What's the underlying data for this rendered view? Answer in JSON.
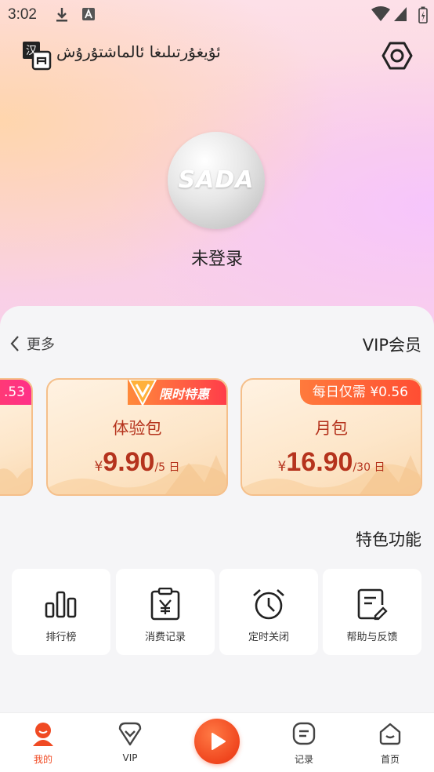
{
  "status_bar": {
    "time": "3:02"
  },
  "header": {
    "app_name": "ئۇيغۇرتىلىغا ئالماشتۇرۇش",
    "lang_icon_text": "汉"
  },
  "profile": {
    "avatar_logo": "SADA",
    "login_status": "未登录"
  },
  "vip": {
    "more_label": "更多",
    "section_title": "VIP会员",
    "partial_card_badge": ".53",
    "plans": [
      {
        "name": "体验包",
        "currency": "¥",
        "price": "9.90",
        "period": "/5 日",
        "badge": "限时特惠"
      },
      {
        "name": "月包",
        "currency": "¥",
        "price": "16.90",
        "period": "/30 日",
        "badge": "每日仅需 ¥0.56"
      }
    ]
  },
  "features": {
    "title": "特色功能",
    "items": [
      {
        "label": "排行榜",
        "icon": "bar-chart-icon"
      },
      {
        "label": "消费记录",
        "icon": "receipt-icon"
      },
      {
        "label": "定时关闭",
        "icon": "alarm-clock-icon"
      },
      {
        "label": "帮助与反馈",
        "icon": "feedback-icon"
      }
    ]
  },
  "tabbar": {
    "items": [
      {
        "label": "我的",
        "icon": "profile-icon",
        "active": true
      },
      {
        "label": "VIP",
        "icon": "vip-heart-icon",
        "active": false
      },
      {
        "label": "记录",
        "icon": "record-icon",
        "active": false
      },
      {
        "label": "首页",
        "icon": "home-icon",
        "active": false
      }
    ],
    "center_icon": "play-icon"
  },
  "colors": {
    "accent": "#f04a23",
    "plan_text": "#b5331d",
    "card_border": "#f5bf8a"
  }
}
